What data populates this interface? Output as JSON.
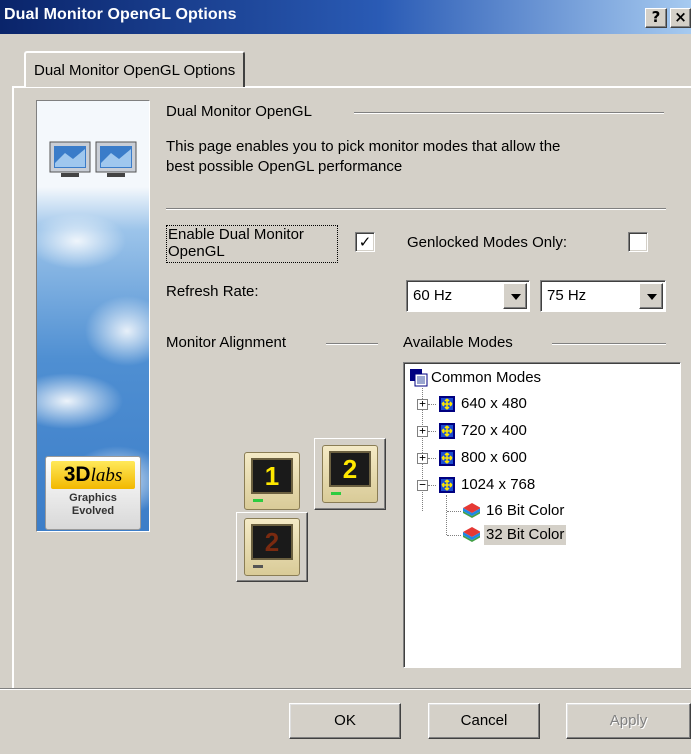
{
  "window": {
    "title": "Dual Monitor OpenGL Options",
    "help_btn": "?",
    "close_btn": "×"
  },
  "tab": {
    "label": "Dual Monitor OpenGL Options"
  },
  "banner": {
    "brand": "3D",
    "brand_suffix": "labs",
    "tagline_1": "Graphics",
    "tagline_2": "Evolved"
  },
  "header": {
    "group_title": "Dual Monitor OpenGL",
    "description_1": "This page enables you to pick monitor modes that allow the",
    "description_2": "best possible OpenGL performance"
  },
  "options": {
    "enable_label_1": "Enable Dual Monitor",
    "enable_label_2": "OpenGL",
    "enable_checked": "✓",
    "genlock_label": "Genlocked Modes Only:",
    "genlock_checked": "",
    "refresh_label": "Refresh Rate:",
    "refresh_1": "60 Hz",
    "refresh_2": "75 Hz"
  },
  "alignment": {
    "label": "Monitor Alignment",
    "monitor_1": "1",
    "monitor_2": "2",
    "monitor_3": "2"
  },
  "modes": {
    "label": "Available Modes",
    "root": "Common Modes",
    "items": [
      "640 x 480",
      "720 x 400",
      "800 x 600",
      "1024 x 768"
    ],
    "children": [
      "16 Bit Color",
      "32 Bit Color"
    ],
    "plus": "+",
    "minus": "−"
  },
  "buttons": {
    "ok": "OK",
    "cancel": "Cancel",
    "apply": "Apply"
  }
}
